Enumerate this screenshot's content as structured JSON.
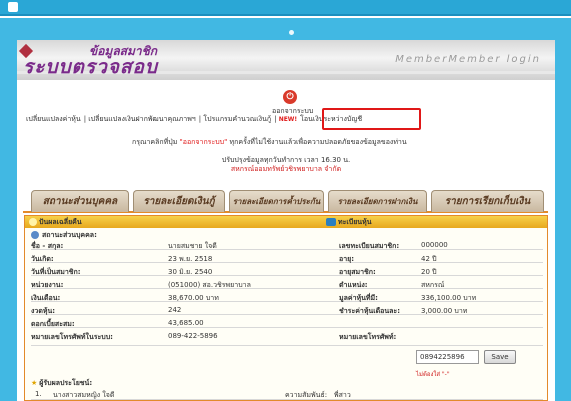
{
  "header": {
    "logo_small": "ข้อมูลสมาชิก",
    "logo_big": "ระบบตรวจสอบ",
    "member_login": "MemberMember login"
  },
  "logout": {
    "label": "ออกจากระบบ"
  },
  "links": {
    "change_shares": "เปลี่ยนแปลงค่าหุ้น",
    "change_deposit": "เปลี่ยนแปลงเงินฝากพัฒนาคุณภาพฯ",
    "loan_calc": "โปรแกรมคำนวณเงินกู้",
    "new_tag": "NEW!",
    "transfer": "โอนเงินระหว่างบัญชี"
  },
  "hint": {
    "prefix": "กรุณาคลิกที่ปุ่ม",
    "button_name": "\"ออกจากระบบ\"",
    "suffix": "ทุกครั้งที่ไม่ใช้งานแล้วเพื่อความปลอดภัยของข้อมูลของท่าน"
  },
  "update_note": "ปรับปรุงข้อมูลทุกวันทำการ เวลา 16.30 น.",
  "coop_name": "สหกรณ์ออมทรัพย์วชิรพยาบาล จำกัด",
  "tabs": [
    "สถานะส่วนบุคคล",
    "รายละเอียดเงินกู้",
    "รายละเอียดการค้ำประกัน",
    "รายละเอียดการฝากเงิน",
    "รายการเรียกเก็บเงิน"
  ],
  "panel": {
    "left_title": "ปันผลเฉลี่ยคืน",
    "right_title": "ทะเบียนหุ้น",
    "section_personal": "สถานะส่วนบุคคล:",
    "section_beneficiary": "ผู้รับผลประโยชน์:",
    "rows": [
      {
        "label": "ชื่อ - สกุล:",
        "value": "นายสมชาย ใจดี",
        "label2": "เลขทะเบียนสมาชิก:",
        "value2": "000000"
      },
      {
        "label": "วันเกิด:",
        "value": "23 พ.ย. 2518",
        "label2": "อายุ:",
        "value2": "42 ปี"
      },
      {
        "label": "วันที่เป็นสมาชิก:",
        "value": "30 มิ.ย. 2540",
        "label2": "อายุสมาชิก:",
        "value2": "20 ปี"
      },
      {
        "label": "หน่วยงาน:",
        "value": "(051000) สอ.วชิรพยาบาล",
        "label2": "ตำแหน่ง:",
        "value2": "สหกรณ์"
      },
      {
        "label": "เงินเดือน:",
        "value": "38,670.00 บาท",
        "label2": "มูลค่าหุ้นที่มี:",
        "value2": "336,100.00 บาท"
      },
      {
        "label": "งวดหุ้น:",
        "value": "242",
        "label2": "ชำระค่าหุ้นเดือนละ:",
        "value2": "3,000.00 บาท"
      },
      {
        "label": "ดอกเบี้ยสะสม:",
        "value": "43,685.00",
        "label2": "",
        "value2": ""
      },
      {
        "label": "หมายเลขโทรศัพท์ในระบบ:",
        "value": "089-422-5896",
        "label2": "หมายเลขโทรศัพท์:",
        "value2": ""
      }
    ],
    "phone_value": "0894225896",
    "save_label": "Save",
    "no_dash_note": "ไม่ต้องใส่ \"-\"",
    "beneficiary": {
      "index": "1.",
      "name": "นางสาวสมหญิง ใจดี",
      "relation_label": "ความสัมพันธ์:",
      "relation_value": "พี่สาว"
    }
  }
}
